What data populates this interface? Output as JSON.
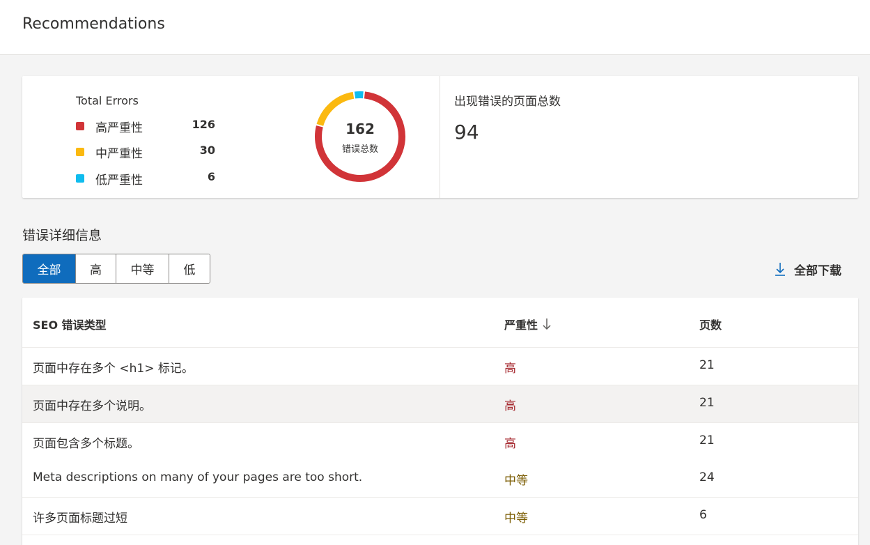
{
  "header": {
    "title": "Recommendations"
  },
  "summary": {
    "total_errors_label": "Total Errors",
    "legend": [
      {
        "label": "高严重性",
        "count": "126",
        "color": "#d13438"
      },
      {
        "label": "中严重性",
        "count": "30",
        "color": "#fbb910"
      },
      {
        "label": "低严重性",
        "count": "6",
        "color": "#0fbcee"
      }
    ],
    "donut": {
      "total": "162",
      "caption": "错误总数",
      "segments": [
        {
          "label": "高严重性",
          "value": 126,
          "color": "#d13438"
        },
        {
          "label": "中严重性",
          "value": 30,
          "color": "#fbb910"
        },
        {
          "label": "低严重性",
          "value": 6,
          "color": "#0fbcee"
        }
      ]
    },
    "pages_with_errors_label": "出现错误的页面总数",
    "pages_with_errors_value": "94"
  },
  "details": {
    "title": "错误详细信息",
    "filters": [
      {
        "label": "全部",
        "active": true
      },
      {
        "label": "高",
        "active": false
      },
      {
        "label": "中等",
        "active": false
      },
      {
        "label": "低",
        "active": false
      }
    ],
    "download_label": "全部下载",
    "download_icon": "download-icon"
  },
  "table": {
    "columns": {
      "type": "SEO 错误类型",
      "severity": "严重性",
      "pages": "页数"
    },
    "sort_icon": "arrow-down-icon",
    "rows": [
      {
        "type": "页面中存在多个 <h1> 标记。",
        "severity": "高",
        "level": "high",
        "pages": "21"
      },
      {
        "type": "页面中存在多个说明。",
        "severity": "高",
        "level": "high",
        "pages": "21"
      },
      {
        "type": "页面包含多个标题。",
        "severity": "高",
        "level": "high",
        "pages": "21"
      },
      {
        "type": "Meta descriptions on many of your pages are too short.",
        "severity": "中等",
        "level": "medium",
        "pages": "24"
      },
      {
        "type": "许多页面标题过短",
        "severity": "中等",
        "level": "medium",
        "pages": "6"
      }
    ]
  }
}
